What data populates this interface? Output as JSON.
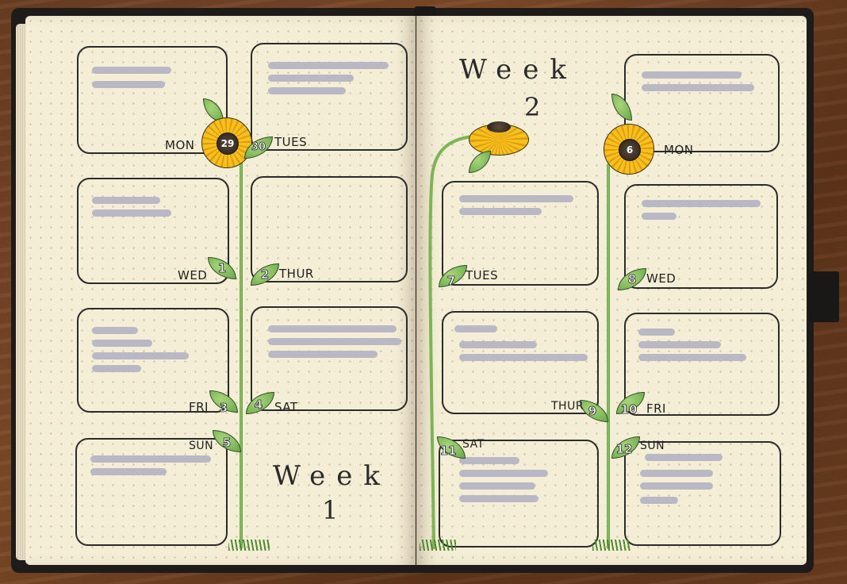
{
  "journal": {
    "left_page": {
      "week_title": "Week",
      "week_number": "1",
      "days": [
        {
          "day": "MON",
          "date": "29"
        },
        {
          "day": "TUES",
          "date": "30"
        },
        {
          "day": "WED",
          "date": "1"
        },
        {
          "day": "THUR",
          "date": "2"
        },
        {
          "day": "FRI",
          "date": "3"
        },
        {
          "day": "SAT",
          "date": "4"
        },
        {
          "day": "SUN",
          "date": "5"
        }
      ]
    },
    "right_page": {
      "week_title": "Week",
      "week_number": "2",
      "days": [
        {
          "day": "MON",
          "date": "6"
        },
        {
          "day": "TUES",
          "date": "7"
        },
        {
          "day": "WED",
          "date": "8"
        },
        {
          "day": "THUR",
          "date": "9"
        },
        {
          "day": "FRI",
          "date": "10"
        },
        {
          "day": "SAT",
          "date": "11"
        },
        {
          "day": "SUN",
          "date": "12"
        }
      ]
    }
  },
  "colors": {
    "paper": "#f4eed6",
    "ink": "#2b2b2b",
    "petal": "#f4c21a",
    "leaf": "#8fc26a",
    "redaction": "#b6b4c4",
    "cover": "#1e1b1a",
    "wood": "#6b3f22"
  }
}
